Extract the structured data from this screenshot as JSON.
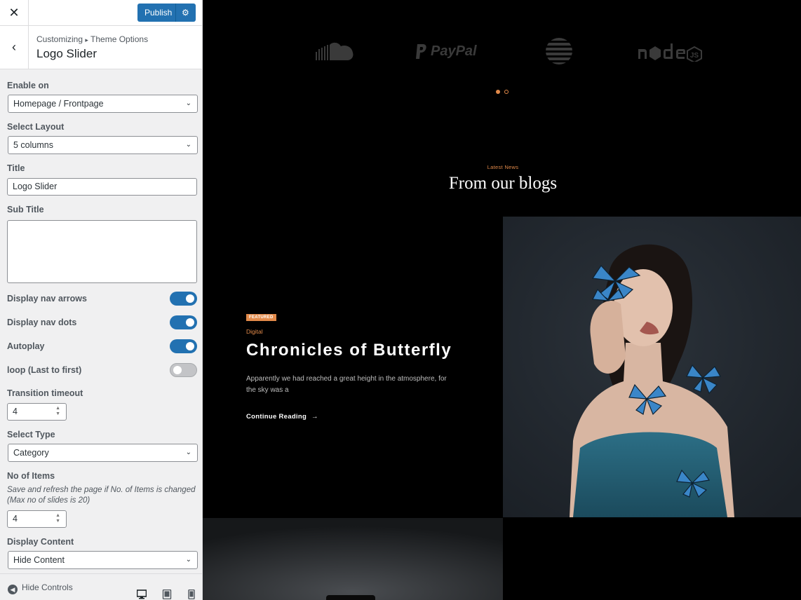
{
  "topbar": {
    "publish_label": "Publish"
  },
  "section": {
    "breadcrumb_root": "Customizing",
    "breadcrumb_sep": "▸",
    "breadcrumb_parent": "Theme Options",
    "title": "Logo Slider"
  },
  "controls": {
    "enable_on": {
      "label": "Enable on",
      "value": "Homepage / Frontpage"
    },
    "layout": {
      "label": "Select Layout",
      "value": "5 columns"
    },
    "title": {
      "label": "Title",
      "value": "Logo Slider"
    },
    "subtitle": {
      "label": "Sub Title",
      "value": ""
    },
    "toggles": [
      {
        "label": "Display nav arrows",
        "on": true
      },
      {
        "label": "Display nav dots",
        "on": true
      },
      {
        "label": "Autoplay",
        "on": true
      },
      {
        "label": "loop (Last to first)",
        "on": false
      }
    ],
    "timeout": {
      "label": "Transition timeout",
      "value": "4"
    },
    "type": {
      "label": "Select Type",
      "value": "Category"
    },
    "items": {
      "label": "No of Items",
      "hint": "Save and refresh the page if No. of Items is changed (Max no of slides is 20)",
      "value": "4"
    },
    "content": {
      "label": "Display Content",
      "value": "Hide Content"
    }
  },
  "footer": {
    "hide_controls_label": "Hide Controls"
  },
  "preview": {
    "logos": [
      "soundcloud-logo",
      "paypal-logo",
      "att-logo",
      "nodejs-logo"
    ],
    "logo_text": {
      "paypal": "PayPal"
    },
    "blog_eyebrow": "Latest News",
    "blog_title": "From our blogs",
    "post": {
      "badge": "FEATURED",
      "category": "Digital",
      "title": "Chronicles of Butterfly",
      "excerpt": "Apparently we had reached a great height in the atmosphere, for the sky was a",
      "read_more": "Continue Reading"
    }
  },
  "colors": {
    "accent": "#2271b1",
    "orange": "#e28a4a",
    "sidebar_bg": "#f0f0f1",
    "preview_bg": "#000000"
  }
}
